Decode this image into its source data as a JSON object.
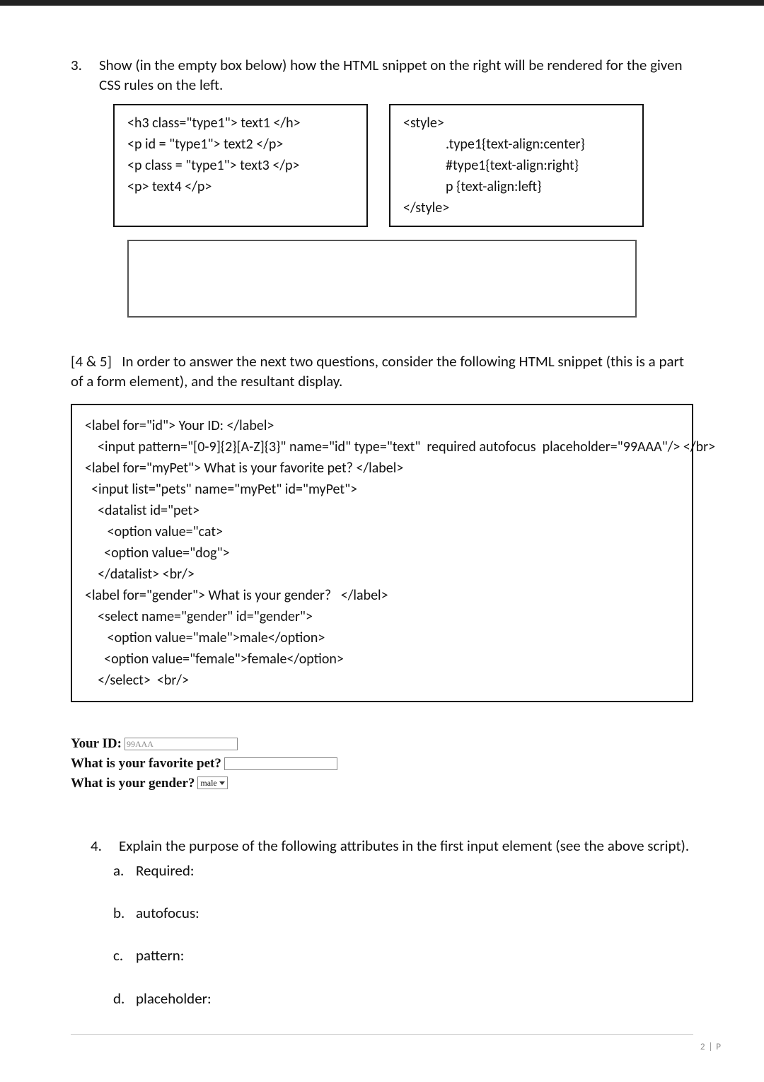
{
  "q3": {
    "number": "3.",
    "prompt": "Show (in the empty box below) how the HTML snippet on the right will be rendered for the given CSS rules on the left.",
    "html_box": {
      "l1": "<h3 class=\"type1\"> text1 </h>",
      "l2": "<p  id = \"type1\"> text2  </p>",
      "l3": "<p  class = \"type1\"> text3  </p>",
      "l4": "<p> text4 </p>"
    },
    "css_box": {
      "open": "<style>",
      "r1": ".type1{text-align:center}",
      "r2": "#type1{text-align:right}",
      "r3": "p {text-align:left}",
      "close": "</style>"
    }
  },
  "q45": {
    "label": "[4 & 5]",
    "prompt": "In order to answer the next two questions, consider the following HTML snippet (this is a part of a form element), and the resultant display.",
    "code": "<label for=\"id\"> Your ID: </label>\n    <input pattern=\"[0-9]{2}[A-Z]{3}\" name=\"id\" type=\"text\"  required autofocus  placeholder=\"99AAA\"/> </br>\n<label for=\"myPet\"> What is your favorite pet? </label>\n  <input list=\"pets\" name=\"myPet\" id=\"myPet\">\n    <datalist id=\"pet>\n       <option value=\"cat>\n      <option value=\"dog\">\n    </datalist> <br/>\n<label for=\"gender\"> What is your gender?   </label>\n    <select name=\"gender\" id=\"gender\">\n       <option value=\"male\">male</option>\n      <option value=\"female\">female</option>\n    </select>  <br/>"
  },
  "rendered_form": {
    "id_label": "Your ID:",
    "id_placeholder": "99AAA",
    "pet_label": "What is your favorite pet?",
    "gender_label": "What is your gender?",
    "gender_value": "male"
  },
  "q4": {
    "number": "4.",
    "prompt": "Explain the purpose of the following attributes in the first input element (see the above script).",
    "items": [
      {
        "letter": "a.",
        "label": "Required:"
      },
      {
        "letter": "b.",
        "label": "autofocus:"
      },
      {
        "letter": "c.",
        "label": "pattern:"
      },
      {
        "letter": "d.",
        "label": "placeholder:"
      }
    ]
  },
  "footer": {
    "page": "2 | P"
  }
}
